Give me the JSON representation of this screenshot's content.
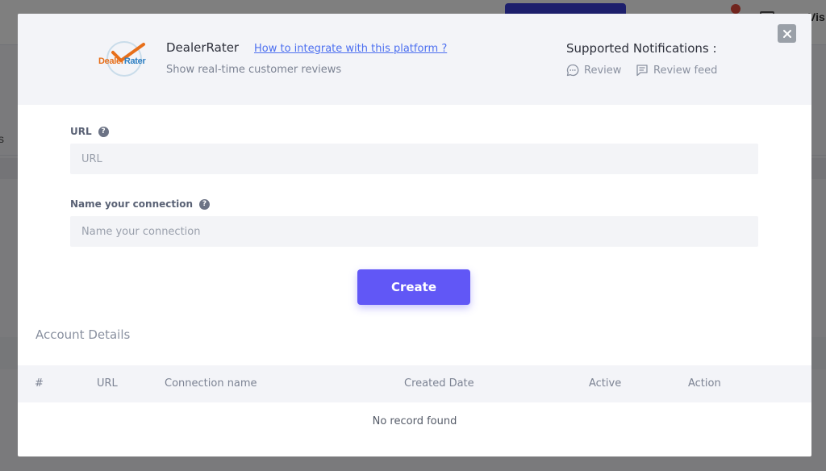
{
  "background": {
    "visible_text_fragment": "Vis",
    "side_text_fragment": "s"
  },
  "modal": {
    "logo": {
      "part1": "Dealer",
      "part2": "Rater",
      "icon": "dealerrater-logo"
    },
    "platform_name": "DealerRater",
    "integrate_link": "How to integrate with this platform ?",
    "description": "Show real-time customer reviews",
    "supported_notifications": {
      "title": "Supported Notifications :",
      "items": [
        {
          "label": "Review",
          "icon": "chat-bubble-icon"
        },
        {
          "label": "Review feed",
          "icon": "message-feed-icon"
        }
      ]
    },
    "close_icon": "close-icon",
    "form": {
      "url": {
        "label": "URL",
        "placeholder": "URL",
        "value": "",
        "help_icon": "question-icon"
      },
      "connection_name": {
        "label": "Name your connection",
        "placeholder": "Name your connection",
        "value": "",
        "help_icon": "question-icon"
      },
      "create_label": "Create"
    },
    "account_details": {
      "title": "Account Details",
      "columns": [
        "#",
        "URL",
        "Connection name",
        "Created Date",
        "Active",
        "Action"
      ],
      "rows": [],
      "empty_text": "No record found"
    }
  },
  "colors": {
    "accent": "#6157f6",
    "link": "#4c6ff0",
    "logo_orange": "#e76f1a",
    "logo_blue": "#2e7fc2"
  }
}
